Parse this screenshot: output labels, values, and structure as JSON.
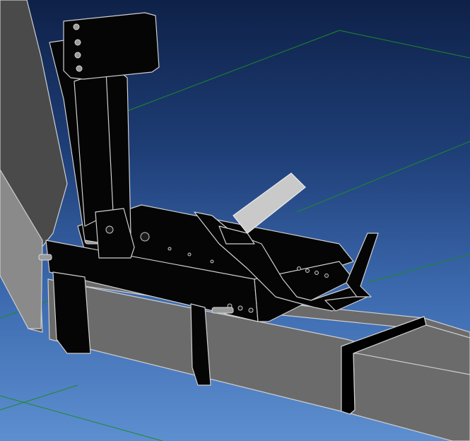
{
  "viewport": {
    "background_top": "#0e2148",
    "background_bottom": "#5d8fd0",
    "grid_color": "#1c8a2a",
    "part_fill": "#050505",
    "tube_fill": "#6b6b6b",
    "edge_color": "#cfcfcf"
  },
  "icons": {
    "grid": "ground-grid-icon"
  }
}
